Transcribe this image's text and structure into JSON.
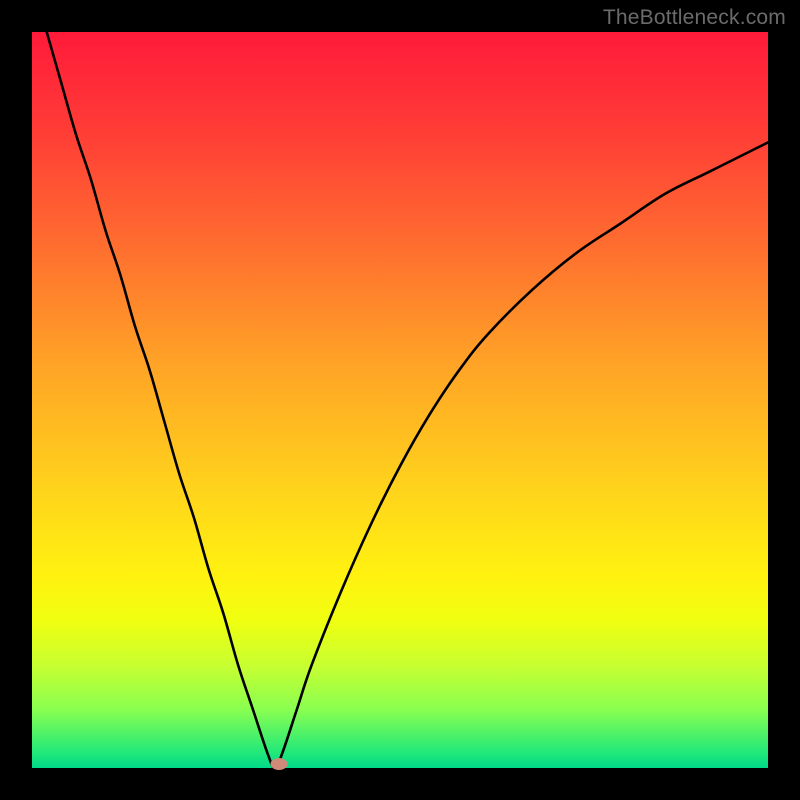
{
  "watermark": "TheBottleneck.com",
  "marker_color": "#cf8a7a",
  "chart_data": {
    "type": "line",
    "title": "",
    "xlabel": "",
    "ylabel": "",
    "xlim": [
      0,
      100
    ],
    "ylim": [
      0,
      100
    ],
    "series": [
      {
        "name": "bottleneck-curve",
        "x": [
          2,
          4,
          6,
          8,
          10,
          12,
          14,
          16,
          18,
          20,
          22,
          24,
          26,
          28,
          30,
          32,
          33,
          34,
          36,
          38,
          42,
          46,
          50,
          54,
          58,
          62,
          68,
          74,
          80,
          86,
          92,
          98,
          100
        ],
        "values": [
          100,
          93,
          86,
          80,
          73,
          67,
          60,
          54,
          47,
          40,
          34,
          27,
          21,
          14,
          8,
          2,
          0,
          2,
          8,
          14,
          24,
          33,
          41,
          48,
          54,
          59,
          65,
          70,
          74,
          78,
          81,
          84,
          85
        ]
      }
    ],
    "marker": {
      "x": 33.5,
      "y": 0.5
    },
    "grid": false,
    "legend": false
  }
}
